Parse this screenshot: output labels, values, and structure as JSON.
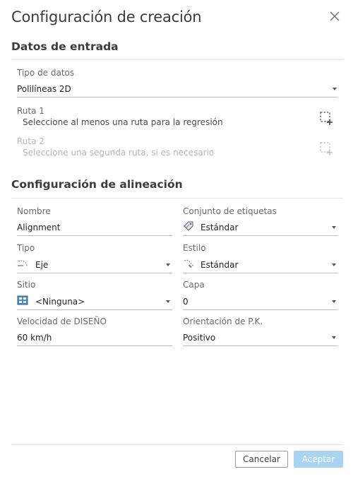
{
  "dialog": {
    "title": "Configuración de creación"
  },
  "input_data": {
    "heading": "Datos de entrada",
    "data_type": {
      "label": "Tipo de datos",
      "value": "Polilíneas 2D"
    },
    "route1": {
      "label": "Ruta 1",
      "hint": "Seleccione al menos una ruta para la regresión"
    },
    "route2": {
      "label": "Ruta 2",
      "hint": "Seleccione una segunda ruta, si es necesario"
    }
  },
  "alignment": {
    "heading": "Configuración de alineación",
    "name": {
      "label": "Nombre",
      "value": "Alignment"
    },
    "label_set": {
      "label": "Conjunto de etiquetas",
      "value": "Estándar",
      "icon": "label-set-icon"
    },
    "type": {
      "label": "Tipo",
      "value": "Eje",
      "icon": "alignment-type-icon"
    },
    "style": {
      "label": "Estilo",
      "value": "Estándar",
      "icon": "alignment-style-icon"
    },
    "site": {
      "label": "Sitio",
      "value": "<Ninguna>",
      "icon": "site-icon"
    },
    "layer": {
      "label": "Capa",
      "value": "0"
    },
    "design_speed": {
      "label": "Velocidad de DISEÑO",
      "value": "60 km/h"
    },
    "station_orientation": {
      "label": "Orientación de P.K.",
      "value": "Positivo"
    }
  },
  "footer": {
    "cancel_label": "Cancelar",
    "accept_label": "Aceptar"
  },
  "colors": {
    "accent_disabled": "#a9d4f0",
    "text": "#3c3c3c"
  }
}
